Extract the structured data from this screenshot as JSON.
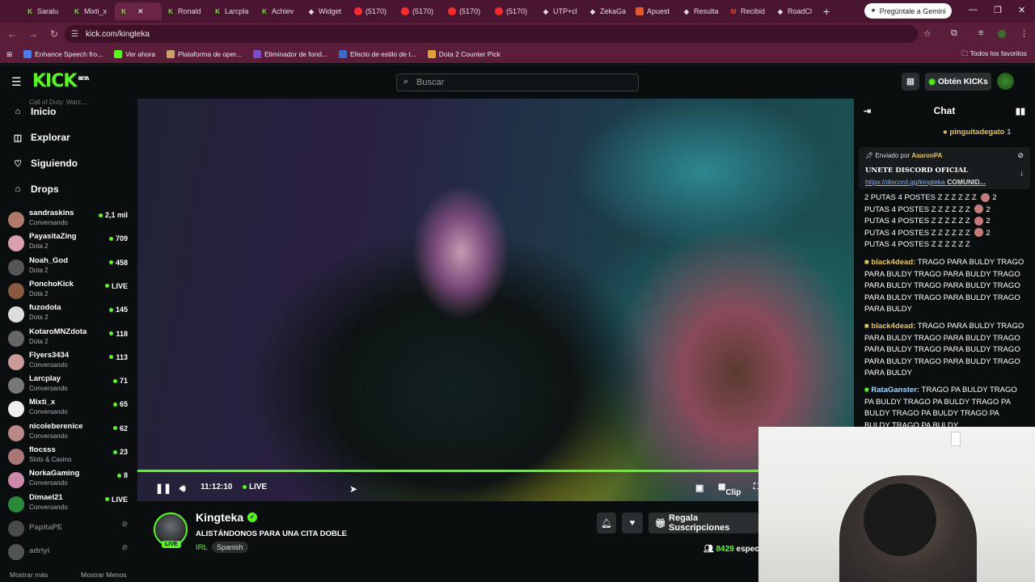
{
  "browser": {
    "tabs": [
      {
        "label": "Saralu",
        "fav": "k"
      },
      {
        "label": "Mixti_x",
        "fav": "k"
      },
      {
        "label": "",
        "fav": "k",
        "active": true
      },
      {
        "label": "Ronald",
        "fav": "k"
      },
      {
        "label": "Larcpla",
        "fav": "k"
      },
      {
        "label": "Achiev",
        "fav": "k"
      },
      {
        "label": "Widget",
        "fav": "g"
      },
      {
        "label": "(5170)",
        "fav": "y"
      },
      {
        "label": "(5170)",
        "fav": "y"
      },
      {
        "label": "(5170)",
        "fav": "y"
      },
      {
        "label": "(5170)",
        "fav": "y"
      },
      {
        "label": "UTP+cl",
        "fav": "g"
      },
      {
        "label": "ZekaGa",
        "fav": "g"
      },
      {
        "label": "Apuest",
        "fav": "r"
      },
      {
        "label": "Resulta",
        "fav": "g"
      },
      {
        "label": "Recibid",
        "fav": "m"
      },
      {
        "label": "RoadCl",
        "fav": "g"
      }
    ],
    "gemini_label": "Pregúntale a Gemini",
    "url": "kick.com/kingteka",
    "bookmarks": [
      "Enhance Speech fro...",
      "Ver ahora",
      "Plataforma de oper...",
      "Eliminador de fond...",
      "Efecto de estilo de t...",
      "Dota 2 Counter Pick"
    ],
    "all_favorites": "Todos los favoritos"
  },
  "header": {
    "logo": "KICK",
    "logo_tag": "BETA",
    "search_placeholder": "Buscar",
    "get_kicks": "Obtén KICKs"
  },
  "sidebar": {
    "nav": [
      {
        "label": "Inicio",
        "icon": "home-icon"
      },
      {
        "label": "Explorar",
        "icon": "compass-icon"
      },
      {
        "label": "Siguiendo",
        "icon": "heart-icon"
      },
      {
        "label": "Drops",
        "icon": "gift-icon"
      }
    ],
    "clipped_text": "Call of Duty: Warz...",
    "channels": [
      {
        "name": "sandraskins",
        "category": "Conversando",
        "viewers": "2,1 mil",
        "color": "#b07a6a"
      },
      {
        "name": "PayasitaZing",
        "category": "Dota 2",
        "viewers": "709",
        "color": "#d9a0b0"
      },
      {
        "name": "Noah_God",
        "category": "Dota 2",
        "viewers": "458",
        "color": "#555"
      },
      {
        "name": "PonchoKick",
        "category": "Dota 2",
        "viewers": "LIVE",
        "color": "#8a5a40"
      },
      {
        "name": "fuzodota",
        "category": "Dota 2",
        "viewers": "145",
        "color": "#ddd"
      },
      {
        "name": "KotaroMNZdota",
        "category": "Dota 2",
        "viewers": "118",
        "color": "#666"
      },
      {
        "name": "Flyers3434",
        "category": "Conversando",
        "viewers": "113",
        "color": "#c99"
      },
      {
        "name": "Larcplay",
        "category": "Conversando",
        "viewers": "71",
        "color": "#777"
      },
      {
        "name": "Mixti_x",
        "category": "Conversando",
        "viewers": "65",
        "color": "#eee"
      },
      {
        "name": "nicoleberenice",
        "category": "Conversando",
        "viewers": "62",
        "color": "#b88"
      },
      {
        "name": "flocsss",
        "category": "Slots & Casino",
        "viewers": "23",
        "color": "#a77"
      },
      {
        "name": "NorkaGaming",
        "category": "Conversando",
        "viewers": "8",
        "color": "#c8a"
      },
      {
        "name": "Dimael21",
        "category": "Conversando",
        "viewers": "LIVE",
        "color": "#2a8a3a"
      }
    ],
    "offline": [
      {
        "name": "PapitaPE",
        "color": "#888"
      },
      {
        "name": "adriyi",
        "color": "#999"
      }
    ],
    "show_more": "Mostrar más",
    "show_less": "Mostrar Menos"
  },
  "player": {
    "time": "11:12:10",
    "live": "LIVE",
    "clip": "Clip"
  },
  "stream": {
    "streamer": "Kingteka",
    "live_badge": "LIVE",
    "title": "ALISTÁNDONOS PARA UNA CITA DOBLE",
    "category": "IRL",
    "language": "Spanish",
    "gift_subs": "Regala Suscripciones",
    "viewers": "8429",
    "viewers_suffix": "espec"
  },
  "chat": {
    "title": "Chat",
    "gifter": "pinguitadegato",
    "gifter_count": "1",
    "pinned_by_label": "Enviado por",
    "pinned_by": "AaaronPA",
    "pinned_title": "UNETE DISCORD OFICIAL",
    "pinned_link": "https://discord.gg/kingteka",
    "pinned_suffix": "COMUNID...",
    "spam_lines": [
      "2 PUTAS 4 POSTES Z Z Z Z Z Z",
      "PUTAS 4 POSTES Z Z Z Z Z Z",
      "PUTAS 4 POSTES Z Z Z Z Z Z",
      "PUTAS 4 POSTES Z Z Z Z Z Z",
      "PUTAS 4 POSTES Z Z Z Z Z Z"
    ],
    "spam_counts": [
      "2",
      "2",
      "2",
      "2"
    ],
    "messages": [
      {
        "user": "black4dead:",
        "color": "#e6c74d",
        "text": "TRAGO PARA BULDY TRAGO PARA BULDY TRAGO PARA BULDY TRAGO PARA BULDY TRAGO PARA BULDY TRAGO PARA BULDY TRAGO PARA BULDY TRAGO PARA BULDY"
      },
      {
        "user": "black4dead:",
        "color": "#e6c74d",
        "text": "TRAGO PARA BULDY TRAGO PARA BULDY TRAGO PARA BULDY TRAGO PARA BULDY TRAGO PARA BULDY TRAGO PARA BULDY TRAGO PARA BULDY TRAGO PARA BULDY"
      },
      {
        "user": "RataGanster:",
        "color": "#53fc18",
        "text": "TRAGO PA BULDY TRAGO PA BULDY TRAGO PA BULDY TRAGO PA BULDY TRAGO PA BULDY TRAGO PA BULDY TRAGO PA BULDY"
      }
    ]
  }
}
